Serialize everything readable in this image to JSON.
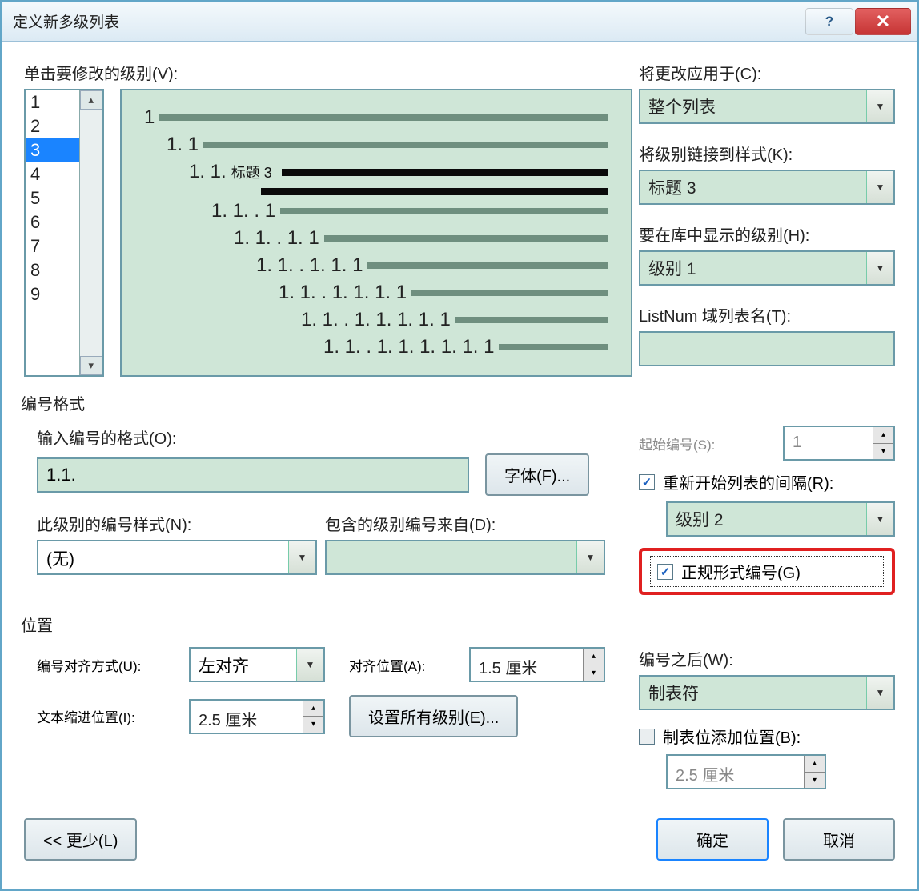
{
  "title": "定义新多级列表",
  "help_icon": "?",
  "close_icon": "✕",
  "section_level_click": "单击要修改的级别(V):",
  "levels": [
    "1",
    "2",
    "3",
    "4",
    "5",
    "6",
    "7",
    "8",
    "9"
  ],
  "selected_level": "3",
  "apply_to_label": "将更改应用于(C):",
  "apply_to_value": "整个列表",
  "link_style_label": "将级别链接到样式(K):",
  "link_style_value": "标题 3",
  "library_level_label": "要在库中显示的级别(H):",
  "library_level_value": "级别 1",
  "listnum_label": "ListNum 域列表名(T):",
  "preview_tag": "标题 3",
  "preview_levels": [
    "1",
    "1. 1",
    "1. 1.",
    "1. 1. . 1",
    "1. 1. . 1. 1",
    "1. 1. . 1. 1. 1",
    "1. 1. . 1. 1. 1. 1",
    "1. 1. . 1. 1. 1. 1. 1",
    "1. 1. . 1. 1. 1. 1. 1. 1"
  ],
  "number_format_section": "编号格式",
  "enter_format_label": "输入编号的格式(O):",
  "enter_format_value": "1.1.",
  "font_button": "字体(F)...",
  "start_at_label": "起始编号(S):",
  "start_at_value": "1",
  "restart_checkbox": "重新开始列表的间隔(R):",
  "restart_value": "级别 2",
  "number_style_label": "此级别的编号样式(N):",
  "number_style_value": "(无)",
  "include_from_label": "包含的级别编号来自(D):",
  "legal_checkbox": "正规形式编号(G)",
  "position_section": "位置",
  "align_label": "编号对齐方式(U):",
  "align_value": "左对齐",
  "align_at_label": "对齐位置(A):",
  "align_at_value": "1.5 厘米",
  "after_number_label": "编号之后(W):",
  "after_number_value": "制表符",
  "text_indent_label": "文本缩进位置(I):",
  "text_indent_value": "2.5 厘米",
  "set_all_button": "设置所有级别(E)...",
  "tab_stop_checkbox": "制表位添加位置(B):",
  "tab_stop_value": "2.5 厘米",
  "less_button": "<< 更少(L)",
  "ok_button": "确定",
  "cancel_button": "取消"
}
